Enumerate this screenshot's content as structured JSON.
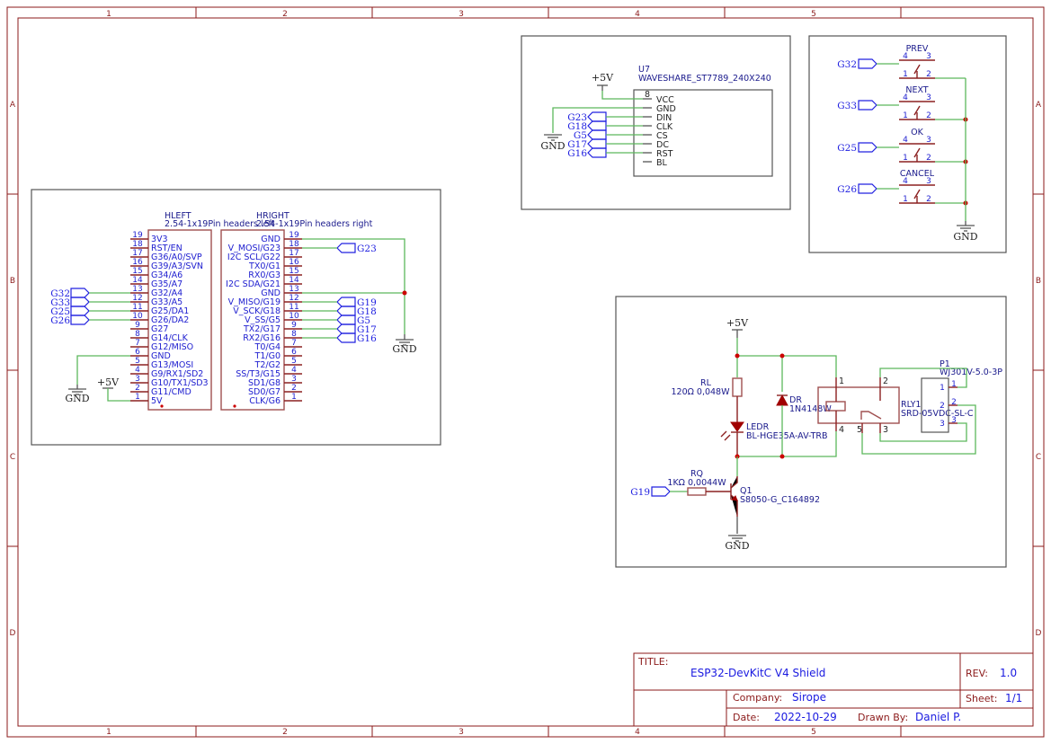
{
  "frame": {
    "columns": [
      "1",
      "2",
      "3",
      "4",
      "5"
    ],
    "rows": [
      "A",
      "B",
      "C",
      "D"
    ]
  },
  "colors": {
    "border": "#8b1a1a",
    "wire": "#5cb85c",
    "net_label": "#2020e0",
    "junction": "#cc0000",
    "component_text": "#1a1a8c"
  },
  "headers": {
    "left": {
      "ref": "HLEFT",
      "value": "2.54-1x19Pin headers left",
      "pins": [
        "3V3",
        "RST/EN",
        "G36/A0/SVP",
        "G39/A3/SVN",
        "G34/A6",
        "G35/A7",
        "G32/A4",
        "G33/A5",
        "G25/DA1",
        "G26/DA2",
        "G27",
        "G14/CLK",
        "G12/MISO",
        "GND",
        "G13/MOSI",
        "G9/RX1/SD2",
        "G10/TX1/SD3",
        "G11/CMD",
        "5V"
      ],
      "pin_numbers": [
        "19",
        "18",
        "17",
        "16",
        "15",
        "14",
        "13",
        "12",
        "11",
        "10",
        "9",
        "8",
        "7",
        "6",
        "5",
        "4",
        "3",
        "2",
        "1"
      ],
      "net_labels": [
        "G32",
        "G33",
        "G25",
        "G26"
      ],
      "gnd": "GND",
      "power": "+5V"
    },
    "right": {
      "ref": "HRIGHT",
      "value": "2.54-1x19Pin headers right",
      "pins": [
        "GND",
        "V_MOSI/G23",
        "I2C SCL/G22",
        "TX0/G1",
        "RX0/G3",
        "I2C SDA/G21",
        "GND",
        "V_MISO/G19",
        "V_SCK/G18",
        "V_SS/G5",
        "TX2/G17",
        "RX2/G16",
        "T0/G4",
        "T1/G0",
        "T2/G2",
        "SS/T3/G15",
        "SD1/G8",
        "SD0/G7",
        "CLK/G6"
      ],
      "pin_numbers": [
        "19",
        "18",
        "17",
        "16",
        "15",
        "14",
        "13",
        "12",
        "11",
        "10",
        "9",
        "8",
        "7",
        "6",
        "5",
        "4",
        "3",
        "2",
        "1"
      ],
      "net_labels": [
        "G23",
        "G19",
        "G18",
        "G5",
        "G17",
        "G16"
      ],
      "gnd": "GND"
    }
  },
  "display": {
    "ref": "U7",
    "value": "WAVESHARE_ST7789_240X240",
    "pin_number": "8",
    "pins": [
      "VCC",
      "GND",
      "DIN",
      "CLK",
      "CS",
      "DC",
      "RST",
      "BL"
    ],
    "net_labels": [
      "G23",
      "G18",
      "G5",
      "G17",
      "G16"
    ],
    "power": "+5V",
    "gnd": "GND"
  },
  "buttons": {
    "items": [
      {
        "label": "PREV",
        "net": "G32"
      },
      {
        "label": "NEXT",
        "net": "G33"
      },
      {
        "label": "OK",
        "net": "G25"
      },
      {
        "label": "CANCEL",
        "net": "G26"
      }
    ],
    "pin_numbers": [
      "4",
      "3",
      "1",
      "2"
    ],
    "gnd": "GND"
  },
  "relay": {
    "power": "+5V",
    "gnd": "GND",
    "rl": {
      "ref": "RL",
      "value": "120Ω 0,048W"
    },
    "dr": {
      "ref": "DR",
      "value": "1N4148W"
    },
    "ledr": {
      "ref": "LEDR",
      "value": "BL-HGE35A-AV-TRB"
    },
    "rq": {
      "ref": "RQ",
      "value": "1KΩ 0,0044W"
    },
    "q1": {
      "ref": "Q1",
      "value": "S8050-G_C164892"
    },
    "rly1": {
      "ref": "RLY1",
      "value": "SRD-05VDC-SL-C",
      "pins": [
        "1",
        "2",
        "4",
        "5",
        "3"
      ]
    },
    "p1": {
      "ref": "P1",
      "value": "WJ301V-5.0-3P",
      "pins": [
        "1",
        "2",
        "3"
      ]
    },
    "net_label": "G19"
  },
  "title_block": {
    "title_label": "TITLE:",
    "title": "ESP32-DevKitC V4 Shield",
    "rev_label": "REV:",
    "rev": "1.0",
    "company_label": "Company:",
    "company": "Sirope",
    "sheet_label": "Sheet:",
    "sheet": "1/1",
    "date_label": "Date:",
    "date": "2022-10-29",
    "drawn_by_label": "Drawn By:",
    "drawn_by": "Daniel P."
  }
}
